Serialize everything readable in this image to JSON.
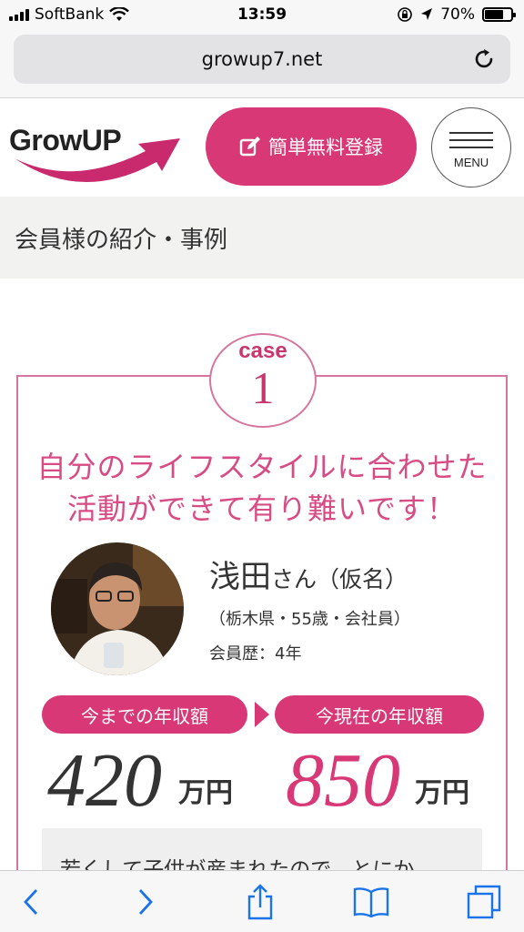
{
  "status_bar": {
    "carrier": "SoftBank",
    "time": "13:59",
    "battery_percent": "70%",
    "battery_level": 0.7
  },
  "browser": {
    "url": "growup7.net"
  },
  "header": {
    "logo_text": "GrowUP",
    "register_label": "簡単無料登録",
    "menu_label": "MENU"
  },
  "section": {
    "title": "会員様の紹介・事例"
  },
  "case": {
    "badge_word": "case",
    "badge_number": "1",
    "headline_line1": "自分のライフスタイルに合わせた",
    "headline_line2": "活動ができて有り難いです！",
    "person_name": "浅田",
    "person_honorific": "さん（仮名）",
    "person_meta": "（栃木県・55歳・会社員）",
    "person_history": "会員歴：4年",
    "before_label": "今までの年収額",
    "after_label": "今現在の年収額",
    "before_income": "420",
    "after_income": "850",
    "income_unit": "万円",
    "quote": "若くして子供が産まれたので、とにか"
  },
  "colors": {
    "brand_pink": "#d93877",
    "headline_pink": "#d84c85",
    "ios_blue": "#1a73e8"
  }
}
